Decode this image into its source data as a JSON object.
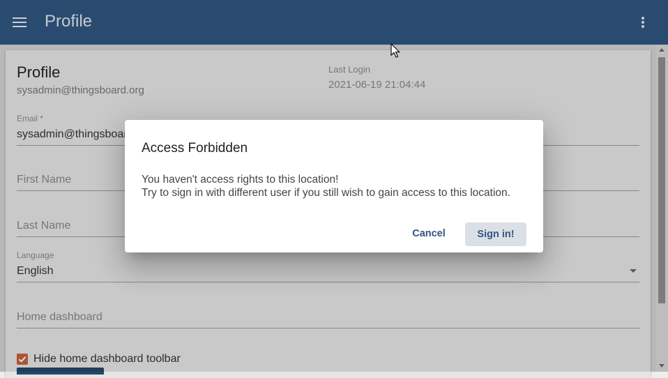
{
  "toolbar": {
    "title": "Profile",
    "menu_icon": "menu-icon",
    "more_icon": "more-vert-icon",
    "background": "#305680"
  },
  "profile": {
    "title": "Profile",
    "subtitle_email": "sysadmin@thingsboard.org",
    "last_login_label": "Last Login",
    "last_login_value": "2021-06-19 21:04:44"
  },
  "form": {
    "email_label": "Email *",
    "email_value": "sysadmin@thingsboard.org",
    "first_name_placeholder": "First Name",
    "last_name_placeholder": "Last Name",
    "language_label": "Language",
    "language_value": "English",
    "home_dashboard_placeholder": "Home dashboard",
    "hide_toolbar_label": "Hide home dashboard toolbar",
    "hide_toolbar_checked": true,
    "accent_color": "#c5613a"
  },
  "dialog": {
    "title": "Access Forbidden",
    "message_line1": "You haven't access rights to this location!",
    "message_line2": "Try to sign in with different user if you still wish to gain access to this location.",
    "cancel_label": "Cancel",
    "signin_label": "Sign in!"
  }
}
